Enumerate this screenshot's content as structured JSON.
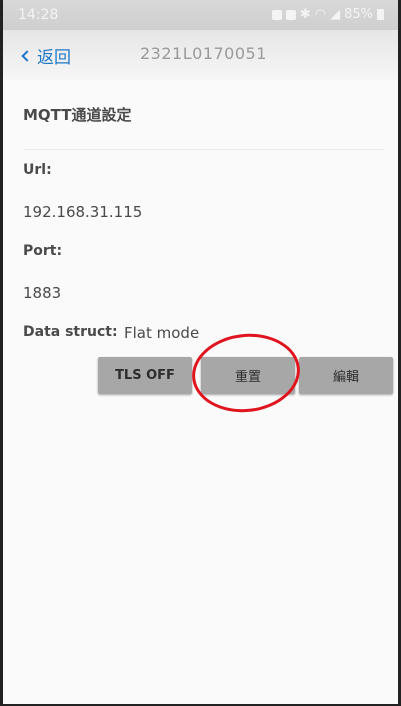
{
  "status_bar": {
    "time": "14:28",
    "battery": "85%"
  },
  "app_bar": {
    "back_label": "返回",
    "title": "2321L0170051"
  },
  "section": {
    "title": "MQTT通道設定"
  },
  "fields": {
    "url_label": "Url:",
    "url_value": "192.168.31.115",
    "port_label": "Port:",
    "port_value": "1883",
    "data_struct_label": "Data struct:",
    "data_struct_value": "Flat mode"
  },
  "buttons": {
    "tls": "TLS OFF",
    "reset": "重置",
    "edit": "編輯"
  },
  "annotation": {
    "highlight_color": "#e0141e",
    "highlighted": "reset-button"
  }
}
